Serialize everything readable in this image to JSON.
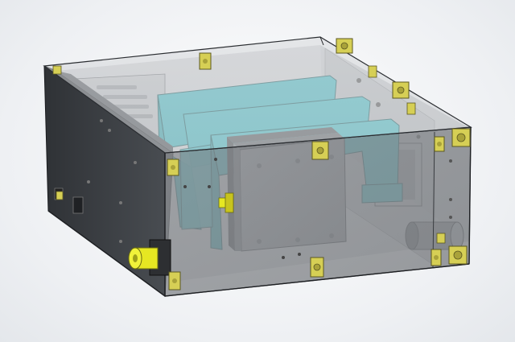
{
  "scene": {
    "subject": "cad-enclosure-assembly",
    "colors": {
      "background": "#f4f5f7",
      "panel_glass": "#8e9296",
      "panel_dark": "#3e4246",
      "bracket_teal": "#45bcc4",
      "module_gray": "#9c9ea2",
      "connector_yellow": "#e7e81f",
      "nut_yellow": "#d8cf5a",
      "edge_line": "#1e2023"
    },
    "components": [
      "enclosure-box",
      "side-panel",
      "front-panel",
      "mounting-bracket",
      "electronics-module",
      "coax-connector",
      "corner-clips",
      "cylindrical-part"
    ]
  }
}
